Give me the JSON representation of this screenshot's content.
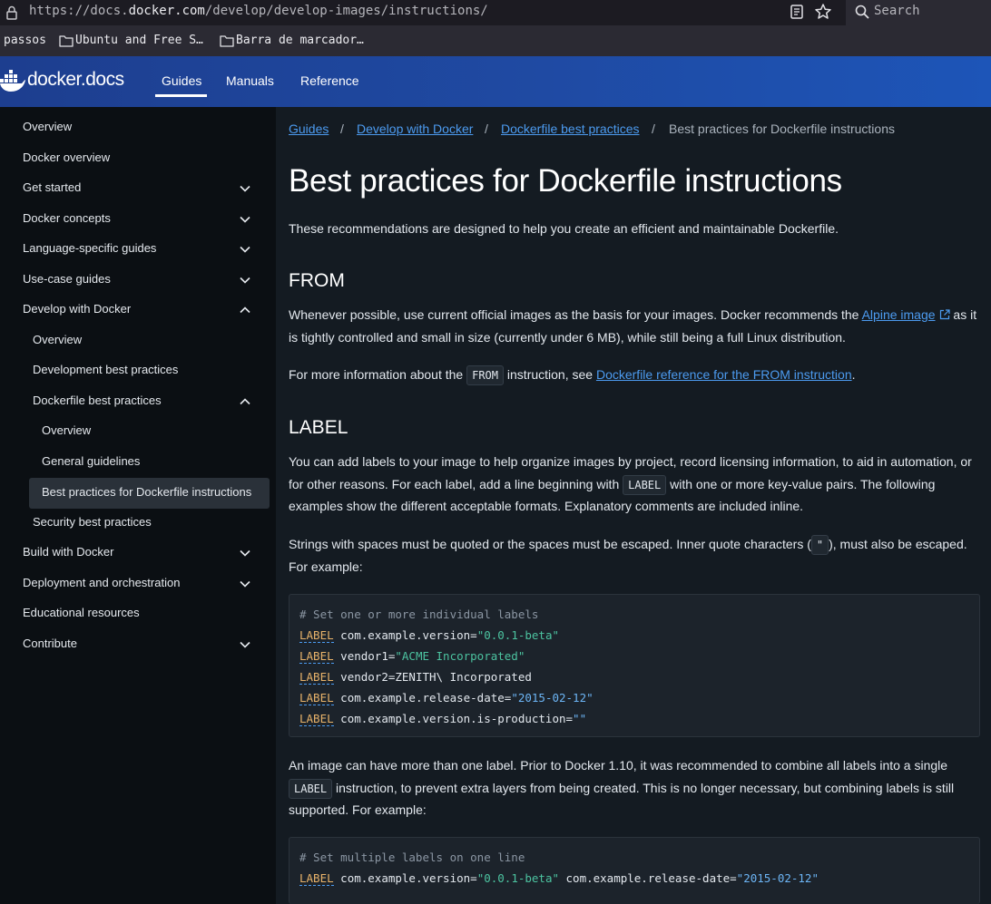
{
  "browser": {
    "url_prefix": "https://docs.",
    "url_host": "docker.com",
    "url_path": "/develop/develop-images/instructions/",
    "search_label": "Search",
    "bookmarks": [
      "passos",
      "Ubuntu and Free S…",
      "Barra de marcador…"
    ]
  },
  "header": {
    "logo_docker": "docker",
    "logo_docs": ".docs",
    "nav": [
      "Guides",
      "Manuals",
      "Reference"
    ],
    "active_nav": "Guides"
  },
  "sidebar": {
    "items": [
      {
        "label": "Overview",
        "expandable": false
      },
      {
        "label": "Docker overview",
        "expandable": false
      },
      {
        "label": "Get started",
        "expandable": true,
        "expanded": false
      },
      {
        "label": "Docker concepts",
        "expandable": true,
        "expanded": false
      },
      {
        "label": "Language-specific guides",
        "expandable": true,
        "expanded": false
      },
      {
        "label": "Use-case guides",
        "expandable": true,
        "expanded": false
      },
      {
        "label": "Develop with Docker",
        "expandable": true,
        "expanded": true
      },
      {
        "label": "Overview",
        "expandable": false
      },
      {
        "label": "Development best practices",
        "expandable": false
      },
      {
        "label": "Dockerfile best practices",
        "expandable": true,
        "expanded": true
      },
      {
        "label": "Overview",
        "expandable": false
      },
      {
        "label": "General guidelines",
        "expandable": false
      },
      {
        "label": "Best practices for Dockerfile instructions",
        "expandable": false,
        "active": true
      },
      {
        "label": "Security best practices",
        "expandable": false
      },
      {
        "label": "Build with Docker",
        "expandable": true,
        "expanded": false
      },
      {
        "label": "Deployment and orchestration",
        "expandable": true,
        "expanded": false
      },
      {
        "label": "Educational resources",
        "expandable": false
      },
      {
        "label": "Contribute",
        "expandable": true,
        "expanded": false
      }
    ]
  },
  "breadcrumb": {
    "items": [
      "Guides",
      "Develop with Docker",
      "Dockerfile best practices"
    ],
    "separator": "/",
    "current": "Best practices for Dockerfile instructions"
  },
  "page": {
    "title": "Best practices for Dockerfile instructions",
    "intro": "These recommendations are designed to help you create an efficient and maintainable Dockerfile.",
    "from": {
      "heading": "FROM",
      "p1_a": "Whenever possible, use current official images as the basis for your images. Docker recommends the ",
      "p1_link": "Alpine image",
      "p1_b": " as it is tightly controlled and small in size (currently under 6 MB), while still being a full Linux distribution.",
      "p2_a": "For more information about the ",
      "p2_code": "FROM",
      "p2_b": " instruction, see ",
      "p2_link": "Dockerfile reference for the FROM instruction",
      "p2_c": "."
    },
    "label": {
      "heading": "LABEL",
      "p1_a": "You can add labels to your image to help organize images by project, record licensing information, to aid in automation, or for other reasons. For each label, add a line beginning with ",
      "p1_code": "LABEL",
      "p1_b": " with one or more key-value pairs. The following examples show the different acceptable formats. Explanatory comments are included inline.",
      "p2_a": "Strings with spaces must be quoted or the spaces must be escaped. Inner quote characters (",
      "p2_code": "\"",
      "p2_b": "), must also be escaped. For example:",
      "code1": {
        "comment": "# Set one or more individual labels",
        "lines": [
          {
            "kw": "LABEL",
            "key": " com.example.version=",
            "val": "\"0.0.1-beta\"",
            "style": "str"
          },
          {
            "kw": "LABEL",
            "key": " vendor1=",
            "val": "\"ACME Incorporated\"",
            "style": "str"
          },
          {
            "kw": "LABEL",
            "key": " vendor2=ZENITH\\ Incorporated",
            "val": "",
            "style": "plain"
          },
          {
            "kw": "LABEL",
            "key": " com.example.release-date=",
            "val": "\"2015-02-12\"",
            "style": "str2"
          },
          {
            "kw": "LABEL",
            "key": " com.example.version.is-production=",
            "val": "\"\"",
            "style": "str2"
          }
        ]
      },
      "p3_a": "An image can have more than one label. Prior to Docker 1.10, it was recommended to combine all labels into a single ",
      "p3_code": "LABEL",
      "p3_b": " instruction, to prevent extra layers from being created. This is no longer necessary, but combining labels is still supported. For example:",
      "code2": {
        "comment": "# Set multiple labels on one line",
        "kw": "LABEL",
        "key1": " com.example.version=",
        "val1": "\"0.0.1-beta\"",
        "key2": " com.example.release-date=",
        "val2": "\"2015-02-12\""
      }
    }
  },
  "colors": {
    "header_blue": "#1f4aa3",
    "link": "#4c9bf0",
    "background": "#141b22",
    "sidebar": "#0b0f13"
  }
}
